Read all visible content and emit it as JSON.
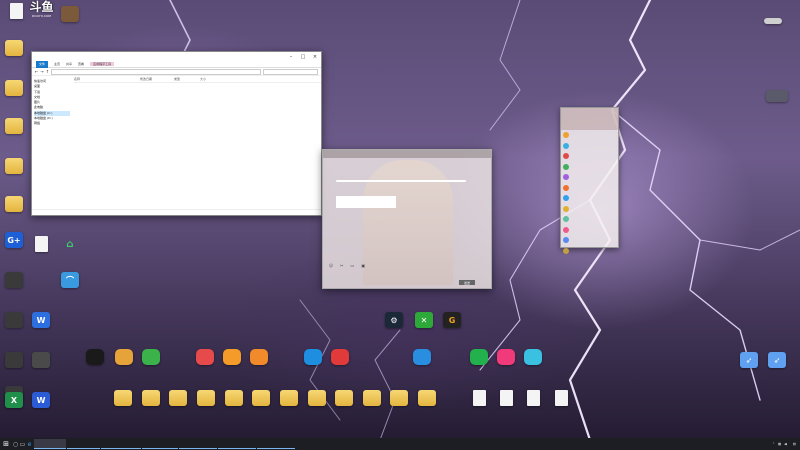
{
  "logo": {
    "text": "斗鱼",
    "site": "DOUYU.COM"
  },
  "desktop": {
    "left_icons": [
      {
        "label": "",
        "icon": "folder"
      },
      {
        "label": "",
        "icon": "folder"
      },
      {
        "label": "",
        "icon": "folder"
      },
      {
        "label": "",
        "icon": "folder"
      },
      {
        "label": "",
        "icon": "folder"
      },
      {
        "label": "",
        "icon": "gplus-icon"
      },
      {
        "label": "",
        "icon": "app"
      },
      {
        "label": "",
        "icon": "app"
      },
      {
        "label": "",
        "icon": "app"
      },
      {
        "label": "",
        "icon": "app"
      },
      {
        "label": "",
        "icon": "excel"
      },
      {
        "label": "",
        "icon": "word"
      }
    ],
    "dock_rows": [
      {
        "label": "",
        "icon": "qq-icon",
        "color": "#1a1a1a"
      },
      {
        "label": "",
        "icon": "owl-icon",
        "color": "#e5a33a"
      },
      {
        "label": "",
        "icon": "wechat-icon",
        "color": "#3bb34a"
      },
      {
        "label": "",
        "icon": "record-icon",
        "color": "#e64a4a"
      },
      {
        "label": "",
        "icon": "chick-icon",
        "color": "#f59b2a"
      },
      {
        "label": "",
        "icon": "game-icon",
        "color": "#f08a2a"
      },
      {
        "label": "",
        "icon": "kugou-icon",
        "color": "#1e8ee0"
      },
      {
        "label": "",
        "icon": "music-icon",
        "color": "#e03a3a"
      },
      {
        "label": "",
        "icon": "ie-icon",
        "color": "#2a8ee0"
      },
      {
        "label": "",
        "icon": "iqiyi-icon",
        "color": "#22b14c"
      },
      {
        "label": "",
        "icon": "youku-icon",
        "color": "#f03a7a"
      },
      {
        "label": "",
        "icon": "play-icon",
        "color": "#3ac0e0"
      }
    ],
    "top_right_icon": {
      "label": ""
    }
  },
  "explorer": {
    "title": "",
    "ribbon_tabs": [
      "文件",
      "主页",
      "共享",
      "查看",
      "应用程序工具"
    ],
    "path": "",
    "search_placeholder": "",
    "nav": [
      "快速访问",
      "桌面",
      "下载",
      "文档",
      "图片",
      "此电脑",
      "本地磁盘 (C:)",
      "本地磁盘 (D:)",
      "网络"
    ],
    "columns": [
      "名称",
      "修改日期",
      "类型",
      "大小"
    ],
    "rows": [],
    "status": ""
  },
  "chat": {
    "title": "",
    "message": "",
    "card": "",
    "send_label": "发送"
  },
  "contacts": {
    "items": [
      "",
      "",
      "",
      "",
      "",
      "",
      "",
      "",
      "",
      "",
      "",
      ""
    ]
  },
  "taskbar": {
    "apps": [
      "",
      "",
      "",
      "",
      "",
      "",
      ""
    ],
    "time": "",
    "date": ""
  }
}
